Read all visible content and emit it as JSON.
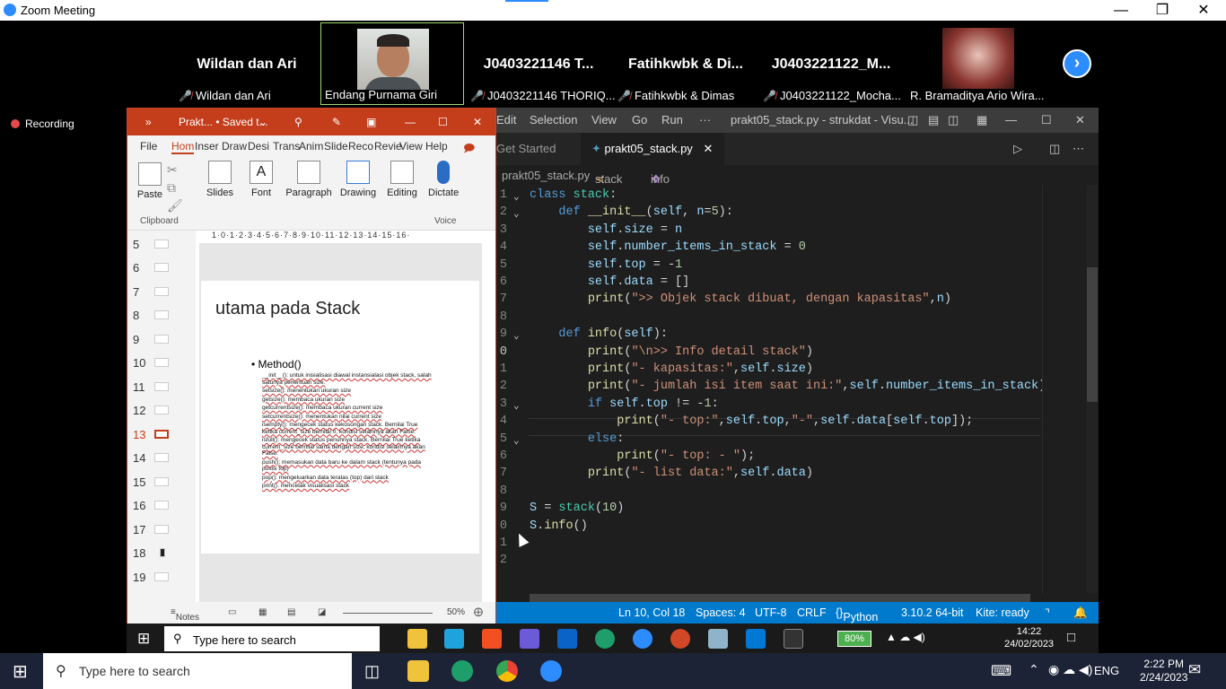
{
  "zoom": {
    "window_title": "Zoom Meeting",
    "recording_label": "Recording",
    "participants": [
      {
        "name_big": "Wildan dan Ari",
        "caption": "Wildan dan Ari",
        "muted": true
      },
      {
        "name_big": "",
        "caption": "Endang Purnama Giri",
        "muted": false
      },
      {
        "name_big": "J0403221146 T...",
        "caption": "J0403221146 THORIQ...",
        "muted": true
      },
      {
        "name_big": "Fatihkwbk & Di...",
        "caption": "Fatihkwbk & Dimas",
        "muted": true
      },
      {
        "name_big": "J0403221122_M...",
        "caption": "J0403221122_Mocha...",
        "muted": true
      },
      {
        "name_big": "",
        "caption": "R. Bramaditya Ario Wira...",
        "muted": false
      }
    ]
  },
  "ppt": {
    "title": "Prakt... • Saved t...",
    "tabs": [
      "File",
      "Hom",
      "Inser",
      "Draw",
      "Desi",
      "Trans",
      "Anim",
      "Slide",
      "Reco",
      "Revie",
      "View",
      "Help"
    ],
    "ribbon": {
      "paste": "Paste",
      "clipboard": "Clipboard",
      "slides": "Slides",
      "font": "Font",
      "paragraph": "Paragraph",
      "drawing": "Drawing",
      "editing": "Editing",
      "dictate": "Dictate",
      "voice": "Voice"
    },
    "ruler": "1·0·1·2·3·4·5·6·7·8·9·10·11·12·13·14·15·16·",
    "slide_numbers": [
      "5",
      "6",
      "7",
      "8",
      "9",
      "10",
      "11",
      "12",
      "13",
      "14",
      "15",
      "16",
      "17",
      "18",
      "19"
    ],
    "current_slide": "13",
    "slide_heading": "utama pada Stack",
    "slide_bullet": "Method()",
    "slide_items": [
      "__init__(): untuk inisialisasi diawal instansialasi objek stack, salah satunya penentuan size.",
      "setsize(): menentukan ukuran size",
      "getsize(): membaca ukuran size",
      "getcurrentsize(): membaca ukuran current size",
      "setcurrentsize(): menentukan nilai current size",
      "isempty(): mengecek status kekosongan stack. Bernilai True ketika current_size bernilai 0, kondisi selainnya akan False.",
      "isfull(): mengecek status penuhnya stack. Bernilai True ketika current_size bernilai sama dengan size, kondisi selainnya akan False.",
      "push(): memasukan data baru ke dalam stack (tentunya pada posisi top)",
      "pop(): mengeluarkan data teratas (top) dari stack",
      "print(): mencetak visualisasi stack"
    ],
    "status_notes": "Notes",
    "zoom_level": "50%"
  },
  "vscode": {
    "menu": [
      "Edit",
      "Selection",
      "View",
      "Go",
      "Run",
      "···"
    ],
    "window_title": "prakt05_stack.py - strukdat - Visu...",
    "tabs": [
      "Get Started",
      "prakt05_stack.py"
    ],
    "breadcrumb": {
      "file": "prakt05_stack.py",
      "cls": "stack",
      "member": "info"
    },
    "line_numbers": [
      "1",
      "2",
      "3",
      "4",
      "5",
      "6",
      "7",
      "8",
      "9",
      "0",
      "1",
      "2",
      "3",
      "4",
      "5",
      "6",
      "7",
      "8",
      "9",
      "0",
      "1",
      "2"
    ],
    "status": {
      "position": "Ln 10, Col 18",
      "spaces": "Spaces: 4",
      "encoding": "UTF-8",
      "eol": "CRLF",
      "language": "Python",
      "interpreter": "3.10.2 64-bit",
      "kite": "Kite: ready"
    }
  },
  "inner_taskbar": {
    "search_placeholder": "Type here to search",
    "battery": "80%",
    "time": "14:22",
    "date": "24/02/2023"
  },
  "taskbar": {
    "search_placeholder": "Type here to search",
    "lang": "ENG",
    "time": "2:22 PM",
    "date": "2/24/2023"
  }
}
